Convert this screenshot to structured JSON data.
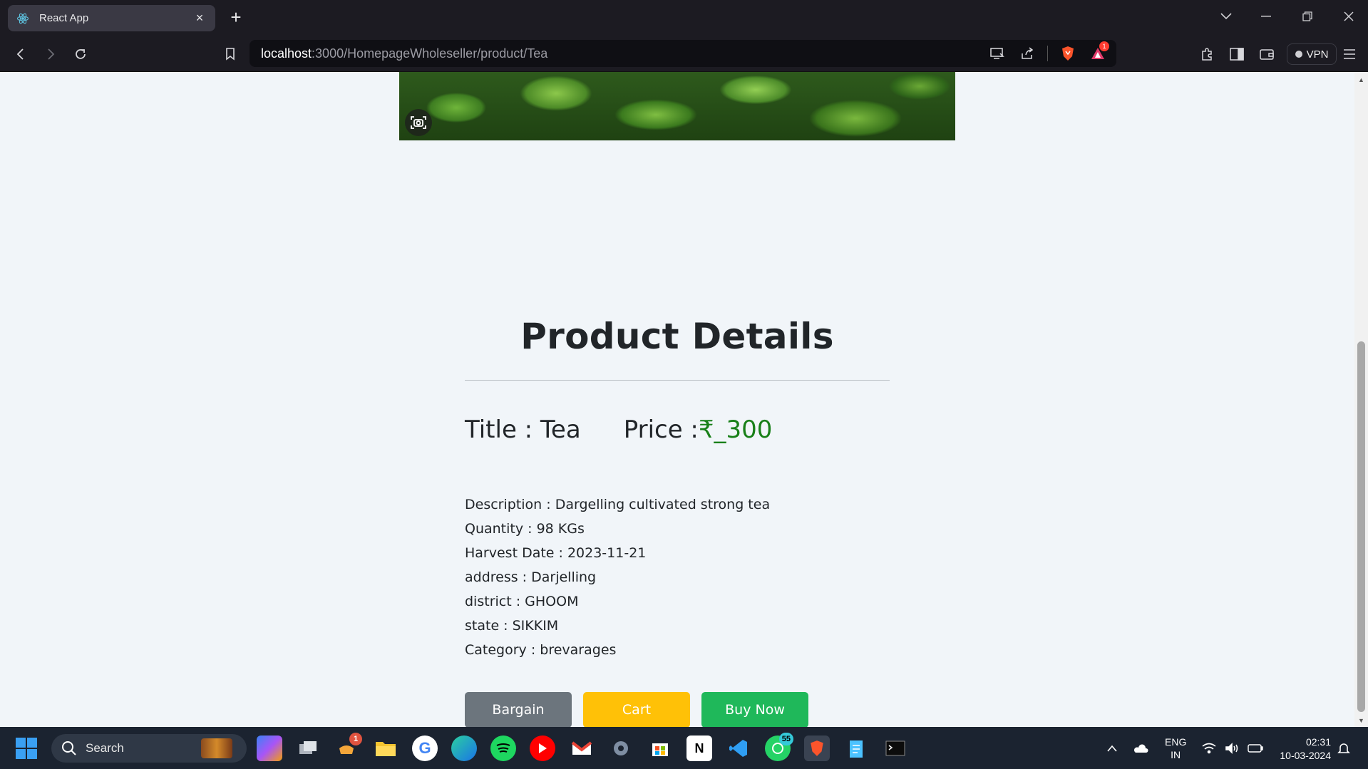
{
  "browser": {
    "tab_title": "React App",
    "url_host": "localhost",
    "url_path": ":3000/HomepageWholeseller/product/Tea",
    "brave_badge_count": "1",
    "vpn_label": "VPN"
  },
  "product": {
    "heading": "Product Details",
    "title_text": "Title : Tea",
    "price_label": "Price : ",
    "price_value": "₹_300",
    "description": "Description : Dargelling cultivated strong tea",
    "quantity": "Quantity : 98 KGs",
    "harvest_date": "Harvest Date : 2023-11-21",
    "address": "address : Darjelling",
    "district": "district : GHOOM",
    "state": "state : SIKKIM",
    "category": "Category : brevarages",
    "buttons": {
      "bargain": "Bargain",
      "cart": "Cart",
      "buy_now": "Buy Now"
    }
  },
  "taskbar": {
    "search_placeholder": "Search",
    "whatsapp_badge": "55",
    "notif_badge": "1",
    "lang_line1": "ENG",
    "lang_line2": "IN",
    "time": "02:31",
    "date": "10-03-2024"
  },
  "colors": {
    "price": "#198019",
    "bargain_button": "#6c757d",
    "cart_button": "#ffc107",
    "buy_button": "#1fb85a",
    "page_background": "#f1f5f9"
  }
}
